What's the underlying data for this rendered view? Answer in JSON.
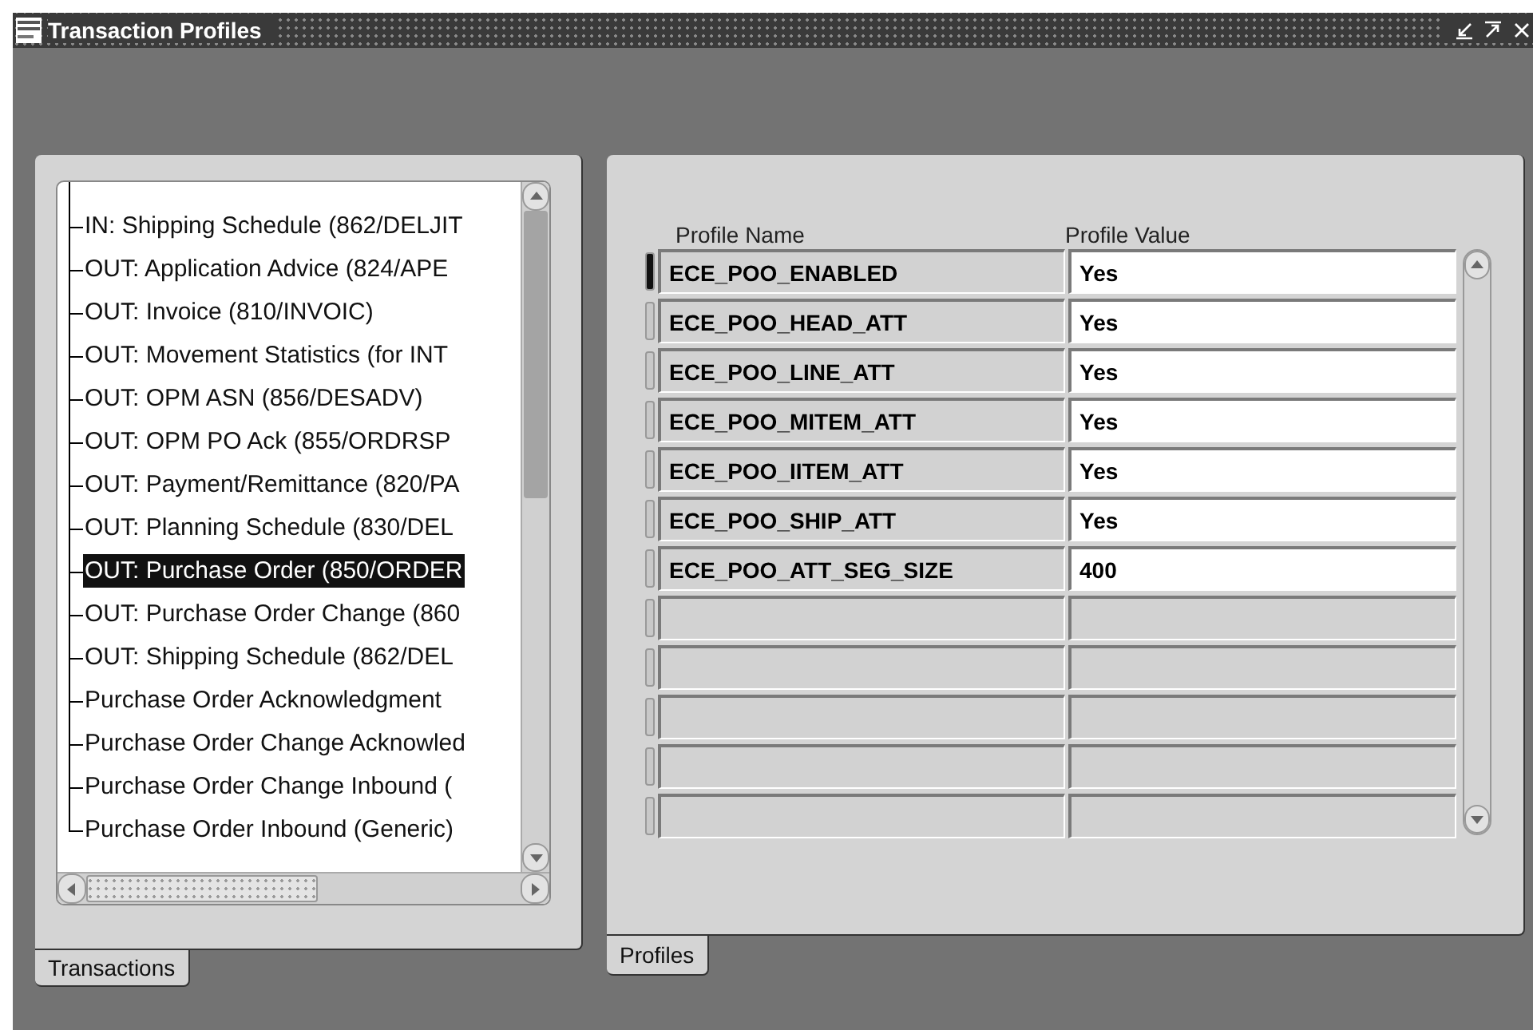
{
  "window": {
    "title": "Transaction Profiles"
  },
  "transactions": {
    "tabs": [
      {
        "label": "Transactions",
        "selected": true
      }
    ],
    "items": [
      {
        "label": "IN: Shipping Schedule (862/DELJIT",
        "selected": false
      },
      {
        "label": "OUT: Application Advice (824/APE",
        "selected": false
      },
      {
        "label": "OUT: Invoice (810/INVOIC)",
        "selected": false
      },
      {
        "label": "OUT: Movement Statistics (for INT",
        "selected": false
      },
      {
        "label": "OUT: OPM ASN (856/DESADV)",
        "selected": false
      },
      {
        "label": "OUT: OPM PO Ack (855/ORDRSP",
        "selected": false
      },
      {
        "label": "OUT: Payment/Remittance (820/PA",
        "selected": false
      },
      {
        "label": "OUT: Planning Schedule (830/DEL",
        "selected": false
      },
      {
        "label": "OUT: Purchase Order (850/ORDER",
        "selected": true
      },
      {
        "label": "OUT: Purchase Order Change (860",
        "selected": false
      },
      {
        "label": "OUT: Shipping Schedule (862/DEL",
        "selected": false
      },
      {
        "label": "Purchase Order Acknowledgment",
        "selected": false
      },
      {
        "label": "Purchase Order Change Acknowled",
        "selected": false
      },
      {
        "label": "Purchase Order Change Inbound (",
        "selected": false
      },
      {
        "label": "Purchase Order Inbound (Generic)",
        "selected": false
      }
    ]
  },
  "profiles": {
    "tabs": [
      {
        "label": "Profiles",
        "selected": true
      }
    ],
    "columns": [
      "Profile Name",
      "Profile Value"
    ],
    "rows": [
      {
        "name": "ECE_POO_ENABLED",
        "value": "Yes",
        "selected": true
      },
      {
        "name": "ECE_POO_HEAD_ATT",
        "value": "Yes",
        "selected": false
      },
      {
        "name": "ECE_POO_LINE_ATT",
        "value": "Yes",
        "selected": false
      },
      {
        "name": "ECE_POO_MITEM_ATT",
        "value": "Yes",
        "selected": false
      },
      {
        "name": "ECE_POO_IITEM_ATT",
        "value": "Yes",
        "selected": false
      },
      {
        "name": "ECE_POO_SHIP_ATT",
        "value": "Yes",
        "selected": false
      },
      {
        "name": "ECE_POO_ATT_SEG_SIZE",
        "value": "400",
        "selected": false
      },
      {
        "selected": false
      },
      {
        "selected": false
      },
      {
        "selected": false
      },
      {
        "selected": false
      },
      {
        "selected": false
      }
    ]
  }
}
